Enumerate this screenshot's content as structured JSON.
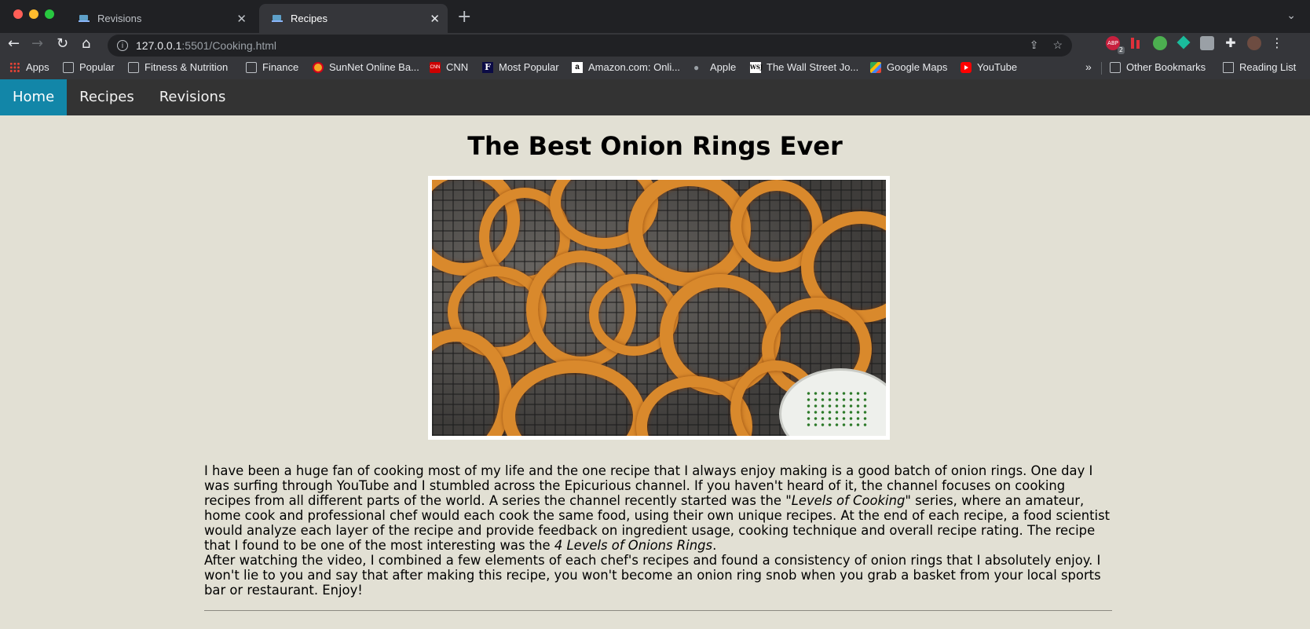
{
  "browser": {
    "tabs": [
      {
        "title": "Revisions"
      },
      {
        "title": "Recipes"
      }
    ],
    "url_host": "127.0.0.1",
    "url_rest": ":5501/Cooking.html",
    "extension_badge": "2",
    "bookmarks": [
      {
        "label": "Apps",
        "icon": "apps-grid-icon"
      },
      {
        "label": "Popular",
        "icon": "folder-icon"
      },
      {
        "label": "Fitness & Nutrition",
        "icon": "folder-icon"
      },
      {
        "label": "Finance",
        "icon": "folder-icon"
      },
      {
        "label": "SunNet Online Ba...",
        "icon": "sunnet-icon"
      },
      {
        "label": "CNN",
        "icon": "cnn-icon"
      },
      {
        "label": "Most Popular",
        "icon": "forbes-icon"
      },
      {
        "label": "Amazon.com: Onli...",
        "icon": "amazon-icon"
      },
      {
        "label": "Apple",
        "icon": "apple-icon"
      },
      {
        "label": "The Wall Street Jo...",
        "icon": "wsj-icon"
      },
      {
        "label": "Google Maps",
        "icon": "google-maps-icon"
      },
      {
        "label": "YouTube",
        "icon": "youtube-icon"
      }
    ],
    "other_bookmarks": "Other Bookmarks",
    "reading_list": "Reading List"
  },
  "site_nav": {
    "items": [
      {
        "label": "Home",
        "active": true
      },
      {
        "label": "Recipes",
        "active": false
      },
      {
        "label": "Revisions",
        "active": false
      }
    ],
    "accent_color": "#1286a8",
    "bar_color": "#333333"
  },
  "article": {
    "title": "The Best Onion Rings Ever",
    "p1_a": "I have been a huge fan of cooking most of my life and the one recipe that I always enjoy making is a good batch of onion rings. One day I was surfing through YouTube and I stumbled across the Epicurious channel. If you haven't heard of it, the channel focuses on cooking recipes from all different parts of the world. A series the channel recently started was the ",
    "p1_em1": "\"Levels of Cooking\"",
    "p1_b": " series, where an amateur, home cook and professional chef would each cook the same food, using their own unique recipes. At the end of each recipe, a food scientist would analyze each layer of the recipe and provide feedback on ingredient usage, cooking technique and overall recipe rating. The recipe that I found to be one of the most interesting was the ",
    "p1_em2": "4 Levels of Onions Rings",
    "p1_c": ".",
    "p2": "After watching the video, I combined a few elements of each chef's recipes and found a consistency of onion rings that I absolutely enjoy. I won't lie to you and say that after making this recipe, you won't become an onion ring snob when you grab a basket from your local sports bar or restaurant. Enjoy!",
    "background_color": "#e2e0d4"
  }
}
